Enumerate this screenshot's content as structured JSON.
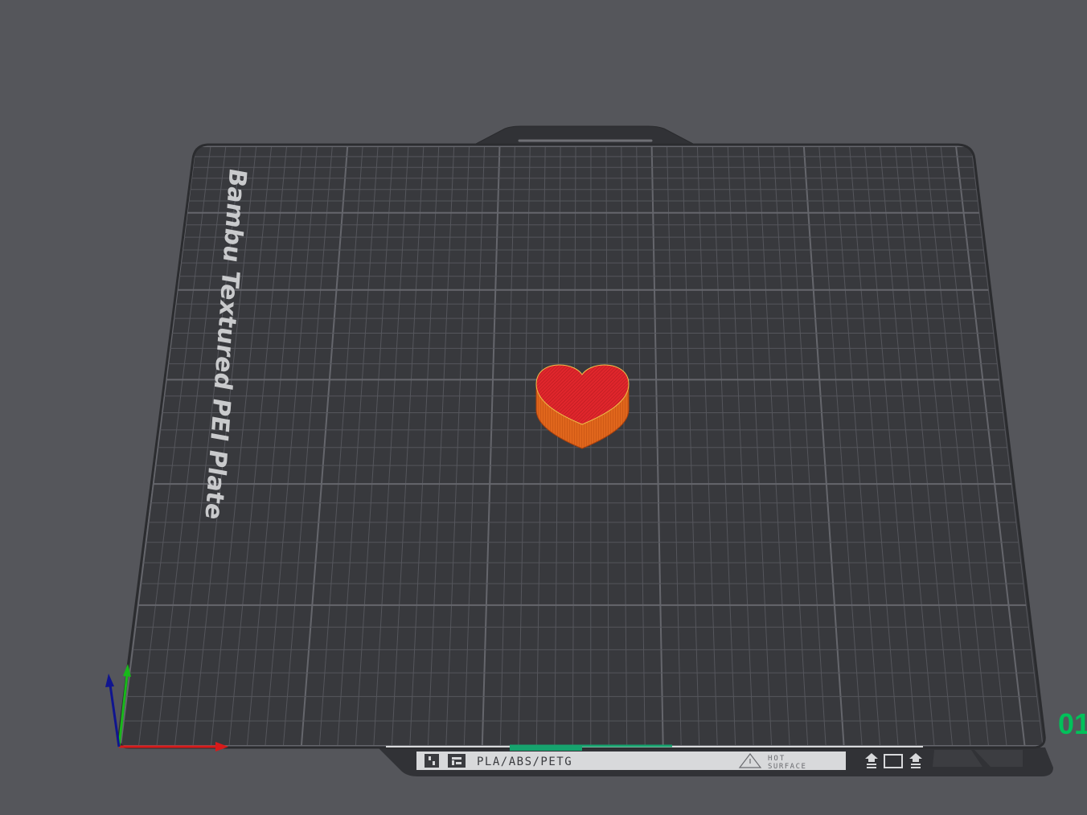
{
  "scene": {
    "background_color": "#55565b",
    "bed_color": "#38393d",
    "grid_color": "#55565c",
    "grid_major_color": "#65666c"
  },
  "plate": {
    "label": "Bambu Textured PEI Plate",
    "material_text": "PLA/ABS/PETG",
    "hot_surface_line1": "HOT",
    "hot_surface_line2": "SURFACE",
    "plate_number": "01",
    "plate_number_color": "#00c15a",
    "accent_color": "#16a36e"
  },
  "model": {
    "name": "heart",
    "top_color": "#e0262c",
    "side_color": "#e0661c"
  },
  "axes": {
    "x_color": "#d81a1a",
    "y_color": "#18b81a",
    "z_color": "#10158f"
  },
  "icons": {
    "bambu_logo": "bambu-logo-icon",
    "warning": "warning-triangle-icon",
    "plate_flip": "plate-flip-icon"
  }
}
